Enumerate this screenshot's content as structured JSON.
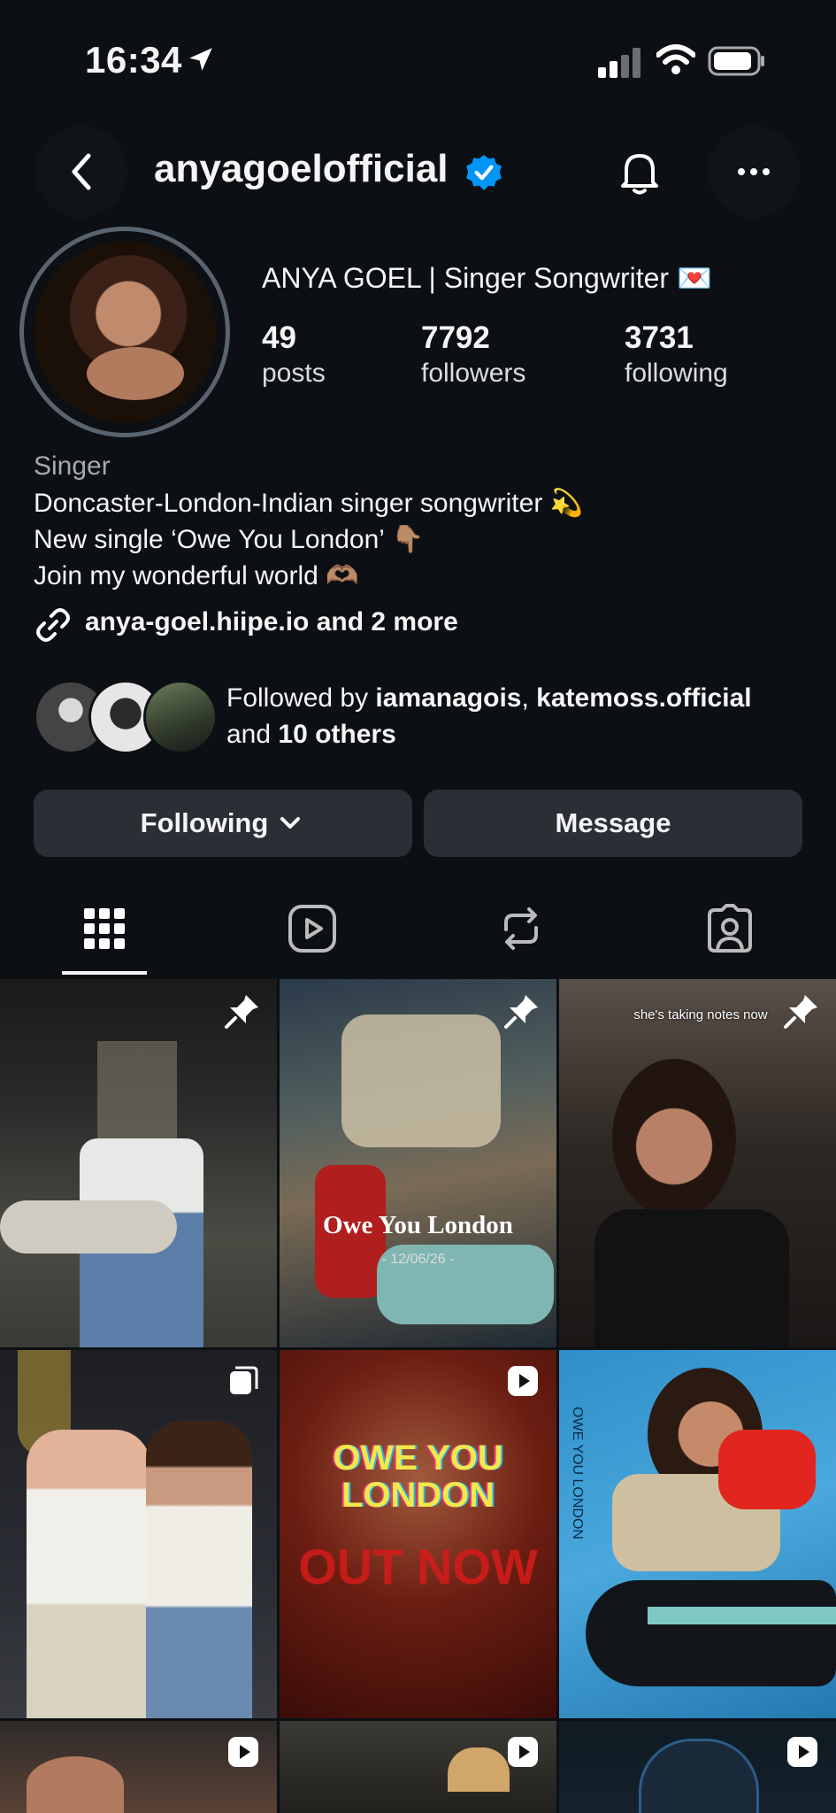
{
  "status_bar": {
    "time": "16:34"
  },
  "header": {
    "username": "anyagoelofficial"
  },
  "profile": {
    "full_name": "ANYA GOEL | Singer Songwriter 💌",
    "stats": [
      {
        "value": "49",
        "label": "posts"
      },
      {
        "value": "7792",
        "label": "followers"
      },
      {
        "value": "3731",
        "label": "following"
      }
    ],
    "category": "Singer",
    "bio_lines": [
      "Doncaster-London-Indian singer songwriter 💫",
      "New single ‘Owe You London’ 👇🏽",
      "Join my wonderful world 🫶🏽"
    ],
    "link": "anya-goel.hiipe.io and 2 more",
    "followed_by": {
      "prefix": "Followed by ",
      "user1": "iamanagois",
      "sep": ", ",
      "user2": "katemoss.official",
      "mid": "and ",
      "others": "10 others"
    }
  },
  "actions": {
    "following_label": "Following",
    "message_label": "Message"
  },
  "tabs": [
    "grid-icon",
    "reels-icon",
    "reposts-icon",
    "tagged-icon"
  ],
  "posts": [
    {
      "badge": "pin-icon"
    },
    {
      "badge": "pin-icon",
      "title": "Owe You London",
      "date": "- 12/06/26 -"
    },
    {
      "badge": "pin-icon",
      "caption": "she's taking notes now"
    },
    {
      "badge": "carousel-icon"
    },
    {
      "badge": "reel-icon",
      "line1": "OWE YOU",
      "line2": "LONDON",
      "line3": "OUT NOW"
    },
    {
      "badge": "none",
      "side_text": "OWE YOU LONDON"
    },
    {
      "badge": "reel-icon"
    },
    {
      "badge": "reel-icon"
    },
    {
      "badge": "reel-icon"
    }
  ],
  "colors": {
    "background": "#0c1014",
    "button": "#2a2f36",
    "verified": "#0095f6"
  }
}
